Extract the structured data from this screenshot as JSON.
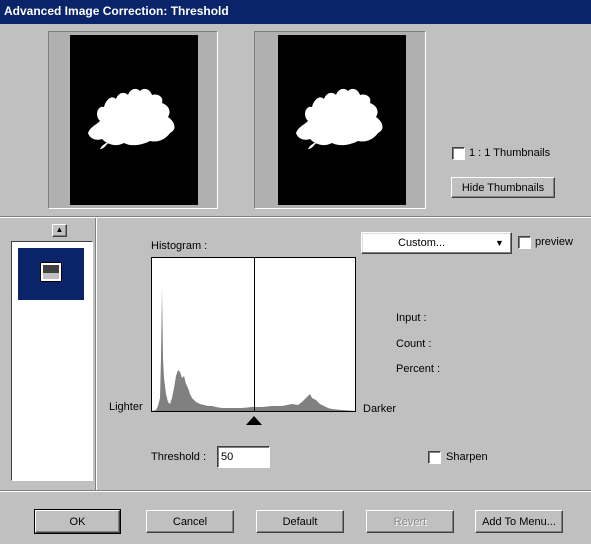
{
  "window": {
    "title": "Advanced Image Correction: Threshold"
  },
  "thumbnails": {
    "one_to_one_label": "1 : 1 Thumbnails",
    "one_to_one_checked": false,
    "hide_button": "Hide Thumbnails"
  },
  "presets": {
    "selected_icon": "image-thumbnail-icon"
  },
  "histogram": {
    "title": "Histogram :",
    "lighter_label": "Lighter",
    "darker_label": "Darker",
    "threshold_label": "Threshold :",
    "threshold_value": "50",
    "threshold_fraction": 0.5
  },
  "mode": {
    "selected": "Custom...",
    "preview_label": "preview",
    "preview_checked": false
  },
  "info": {
    "input_label": "Input :",
    "count_label": "Count :",
    "percent_label": "Percent :"
  },
  "sharpen": {
    "label": "Sharpen",
    "checked": false
  },
  "buttons": {
    "ok": "OK",
    "cancel": "Cancel",
    "default": "Default",
    "revert": "Revert",
    "add_to_menu": "Add To Menu..."
  },
  "colors": {
    "title_bar": "#0a246a",
    "face": "#c0c0c0",
    "histogram_fill": "#808080"
  }
}
